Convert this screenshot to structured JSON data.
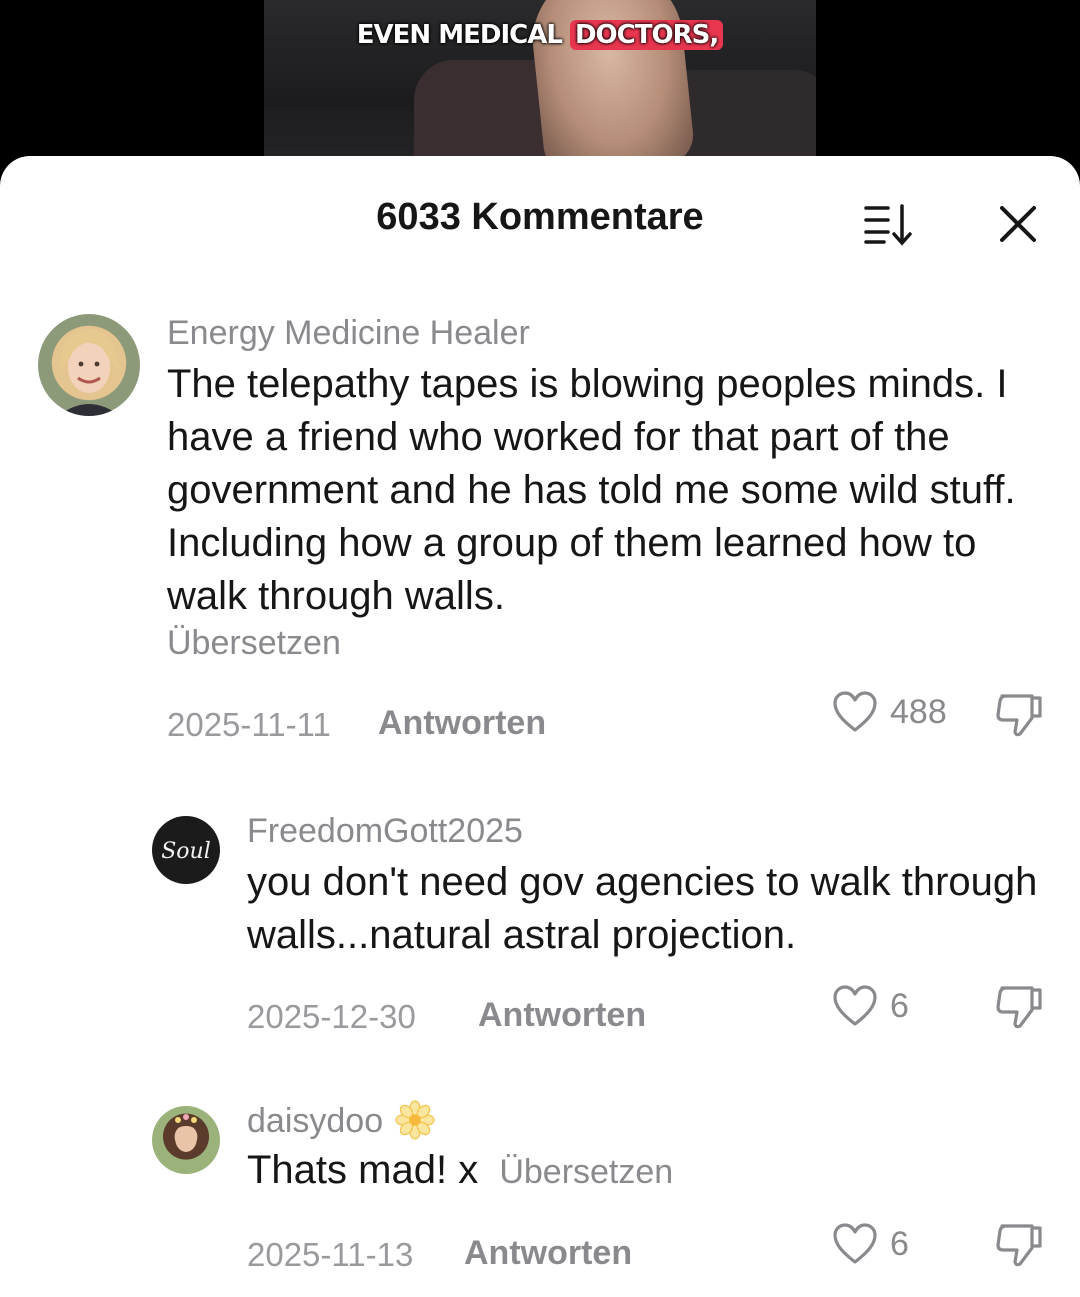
{
  "video": {
    "caption_part1": "EVEN MEDICAL",
    "caption_part2": "DOCTORS,"
  },
  "header": {
    "title": "6033 Kommentare"
  },
  "comments": [
    {
      "username": "Energy Medicine Healer",
      "text": "The telepathy tapes is blowing peoples minds. I have a friend who worked for that part of the government and he has told me some wild stuff. Including how a group of them learned how to walk through walls.",
      "translate": "Übersetzen",
      "date": "2025-11-11",
      "reply": "Antworten",
      "likes": "488"
    },
    {
      "username": "FreedomGott2025",
      "avatar_text": "Soul",
      "text": "you don't need gov agencies to walk through walls...natural astral projection.",
      "date": "2025-12-30",
      "reply": "Antworten",
      "likes": "6"
    },
    {
      "username": "daisydoo",
      "username_emoji": "flower-icon",
      "text": "Thats mad! x",
      "translate": "Übersetzen",
      "date": "2025-11-13",
      "reply": "Antworten",
      "likes": "6"
    }
  ],
  "colors": {
    "text": "#161616",
    "muted": "#8a8a8e",
    "caption_highlight": "#e8364f"
  }
}
